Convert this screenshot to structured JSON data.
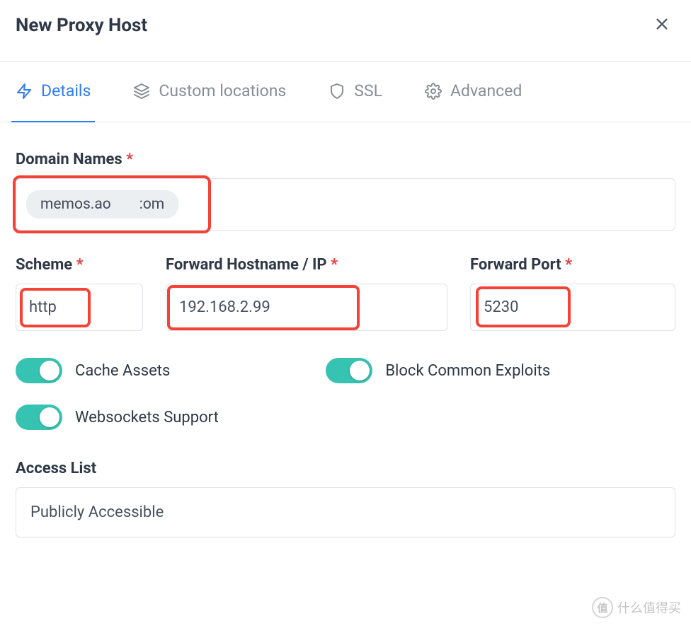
{
  "header": {
    "title": "New Proxy Host"
  },
  "tabs": {
    "details": "Details",
    "custom_locations": "Custom locations",
    "ssl": "SSL",
    "advanced": "Advanced"
  },
  "fields": {
    "domain_names": {
      "label": "Domain Names",
      "chip_prefix": "memos.ao",
      "chip_suffix": ":om"
    },
    "scheme": {
      "label": "Scheme",
      "value": "http"
    },
    "forward_host": {
      "label": "Forward Hostname / IP",
      "value": "192.168.2.99"
    },
    "forward_port": {
      "label": "Forward Port",
      "value": "5230"
    }
  },
  "toggles": {
    "cache_assets": "Cache Assets",
    "block_exploits": "Block Common Exploits",
    "websockets": "Websockets Support"
  },
  "access_list": {
    "label": "Access List",
    "value": "Publicly Accessible"
  },
  "watermark": {
    "badge": "值",
    "text": "什么值得买"
  }
}
